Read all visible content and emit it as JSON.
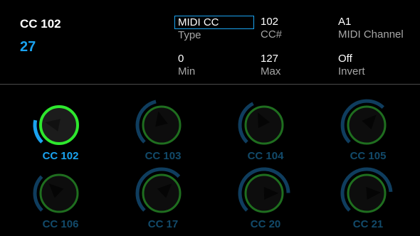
{
  "param": {
    "title": "CC 102",
    "value": "27"
  },
  "fields": {
    "type": {
      "value": "MIDI CC",
      "label": "Type"
    },
    "cc_number": {
      "value": "102",
      "label": "CC#"
    },
    "midi_channel": {
      "value": "A1",
      "label": "MIDI Channel"
    },
    "min": {
      "value": "0",
      "label": "Min"
    },
    "max": {
      "value": "127",
      "label": "Max"
    },
    "invert": {
      "value": "Off",
      "label": "Invert"
    }
  },
  "knobs": [
    {
      "label": "CC 102",
      "level": 0.21,
      "active": true
    },
    {
      "label": "CC 103",
      "level": 0.45,
      "active": false
    },
    {
      "label": "CC 104",
      "level": 0.4,
      "active": false
    },
    {
      "label": "CC 105",
      "level": 0.66,
      "active": false
    },
    {
      "label": "CC 106",
      "level": 0.33,
      "active": false
    },
    {
      "label": "CC 17",
      "level": 0.67,
      "active": false
    },
    {
      "label": "CC 20",
      "level": 0.83,
      "active": false
    },
    {
      "label": "CC 21",
      "level": 0.82,
      "active": false
    }
  ],
  "colors": {
    "accent": "#1aa3f0",
    "arc_inactive": "#0f3d5e",
    "knob_active": "#2ee82e",
    "knob_inactive": "#1f6e1f",
    "label_inactive": "#124a6a"
  }
}
